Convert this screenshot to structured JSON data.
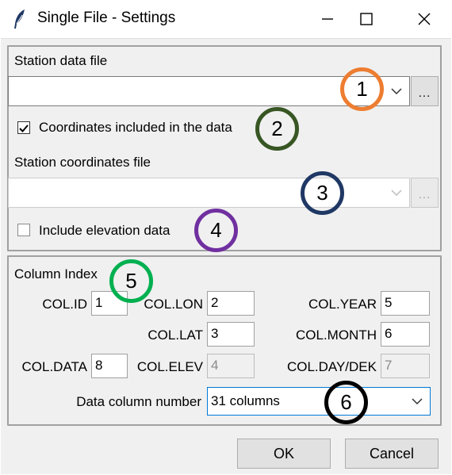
{
  "window": {
    "title": "Single File - Settings",
    "minimize_icon": "minimize-icon",
    "maximize_icon": "maximize-icon",
    "close_icon": "close-icon"
  },
  "file_group": {
    "station_data_label": "Station data file",
    "station_data_value": "",
    "browse_label": "...",
    "coords_included_label": "Coordinates included in the data",
    "coords_included_checked": true,
    "station_coords_label": "Station coordinates file",
    "station_coords_value": "",
    "include_elevation_label": "Include elevation data",
    "include_elevation_checked": false
  },
  "column_index": {
    "title": "Column Index",
    "fields": {
      "col_id": {
        "label": "COL.ID",
        "value": "1"
      },
      "col_lon": {
        "label": "COL.LON",
        "value": "2"
      },
      "col_year": {
        "label": "COL.YEAR",
        "value": "5"
      },
      "col_lat": {
        "label": "COL.LAT",
        "value": "3"
      },
      "col_month": {
        "label": "COL.MONTH",
        "value": "6"
      },
      "col_data": {
        "label": "COL.DATA",
        "value": "8"
      },
      "col_elev": {
        "label": "COL.ELEV",
        "value": "4"
      },
      "col_daydek": {
        "label": "COL.DAY/DEK",
        "value": "7"
      }
    },
    "data_column_label": "Data column number",
    "data_column_value": "31 columns"
  },
  "buttons": {
    "ok": "OK",
    "cancel": "Cancel"
  },
  "annotations": [
    {
      "number": "1",
      "color": "#ed7d31"
    },
    {
      "number": "2",
      "color": "#375623"
    },
    {
      "number": "3",
      "color": "#1f3864"
    },
    {
      "number": "4",
      "color": "#7030a0"
    },
    {
      "number": "5",
      "color": "#00b050"
    },
    {
      "number": "6",
      "color": "#000000"
    }
  ]
}
